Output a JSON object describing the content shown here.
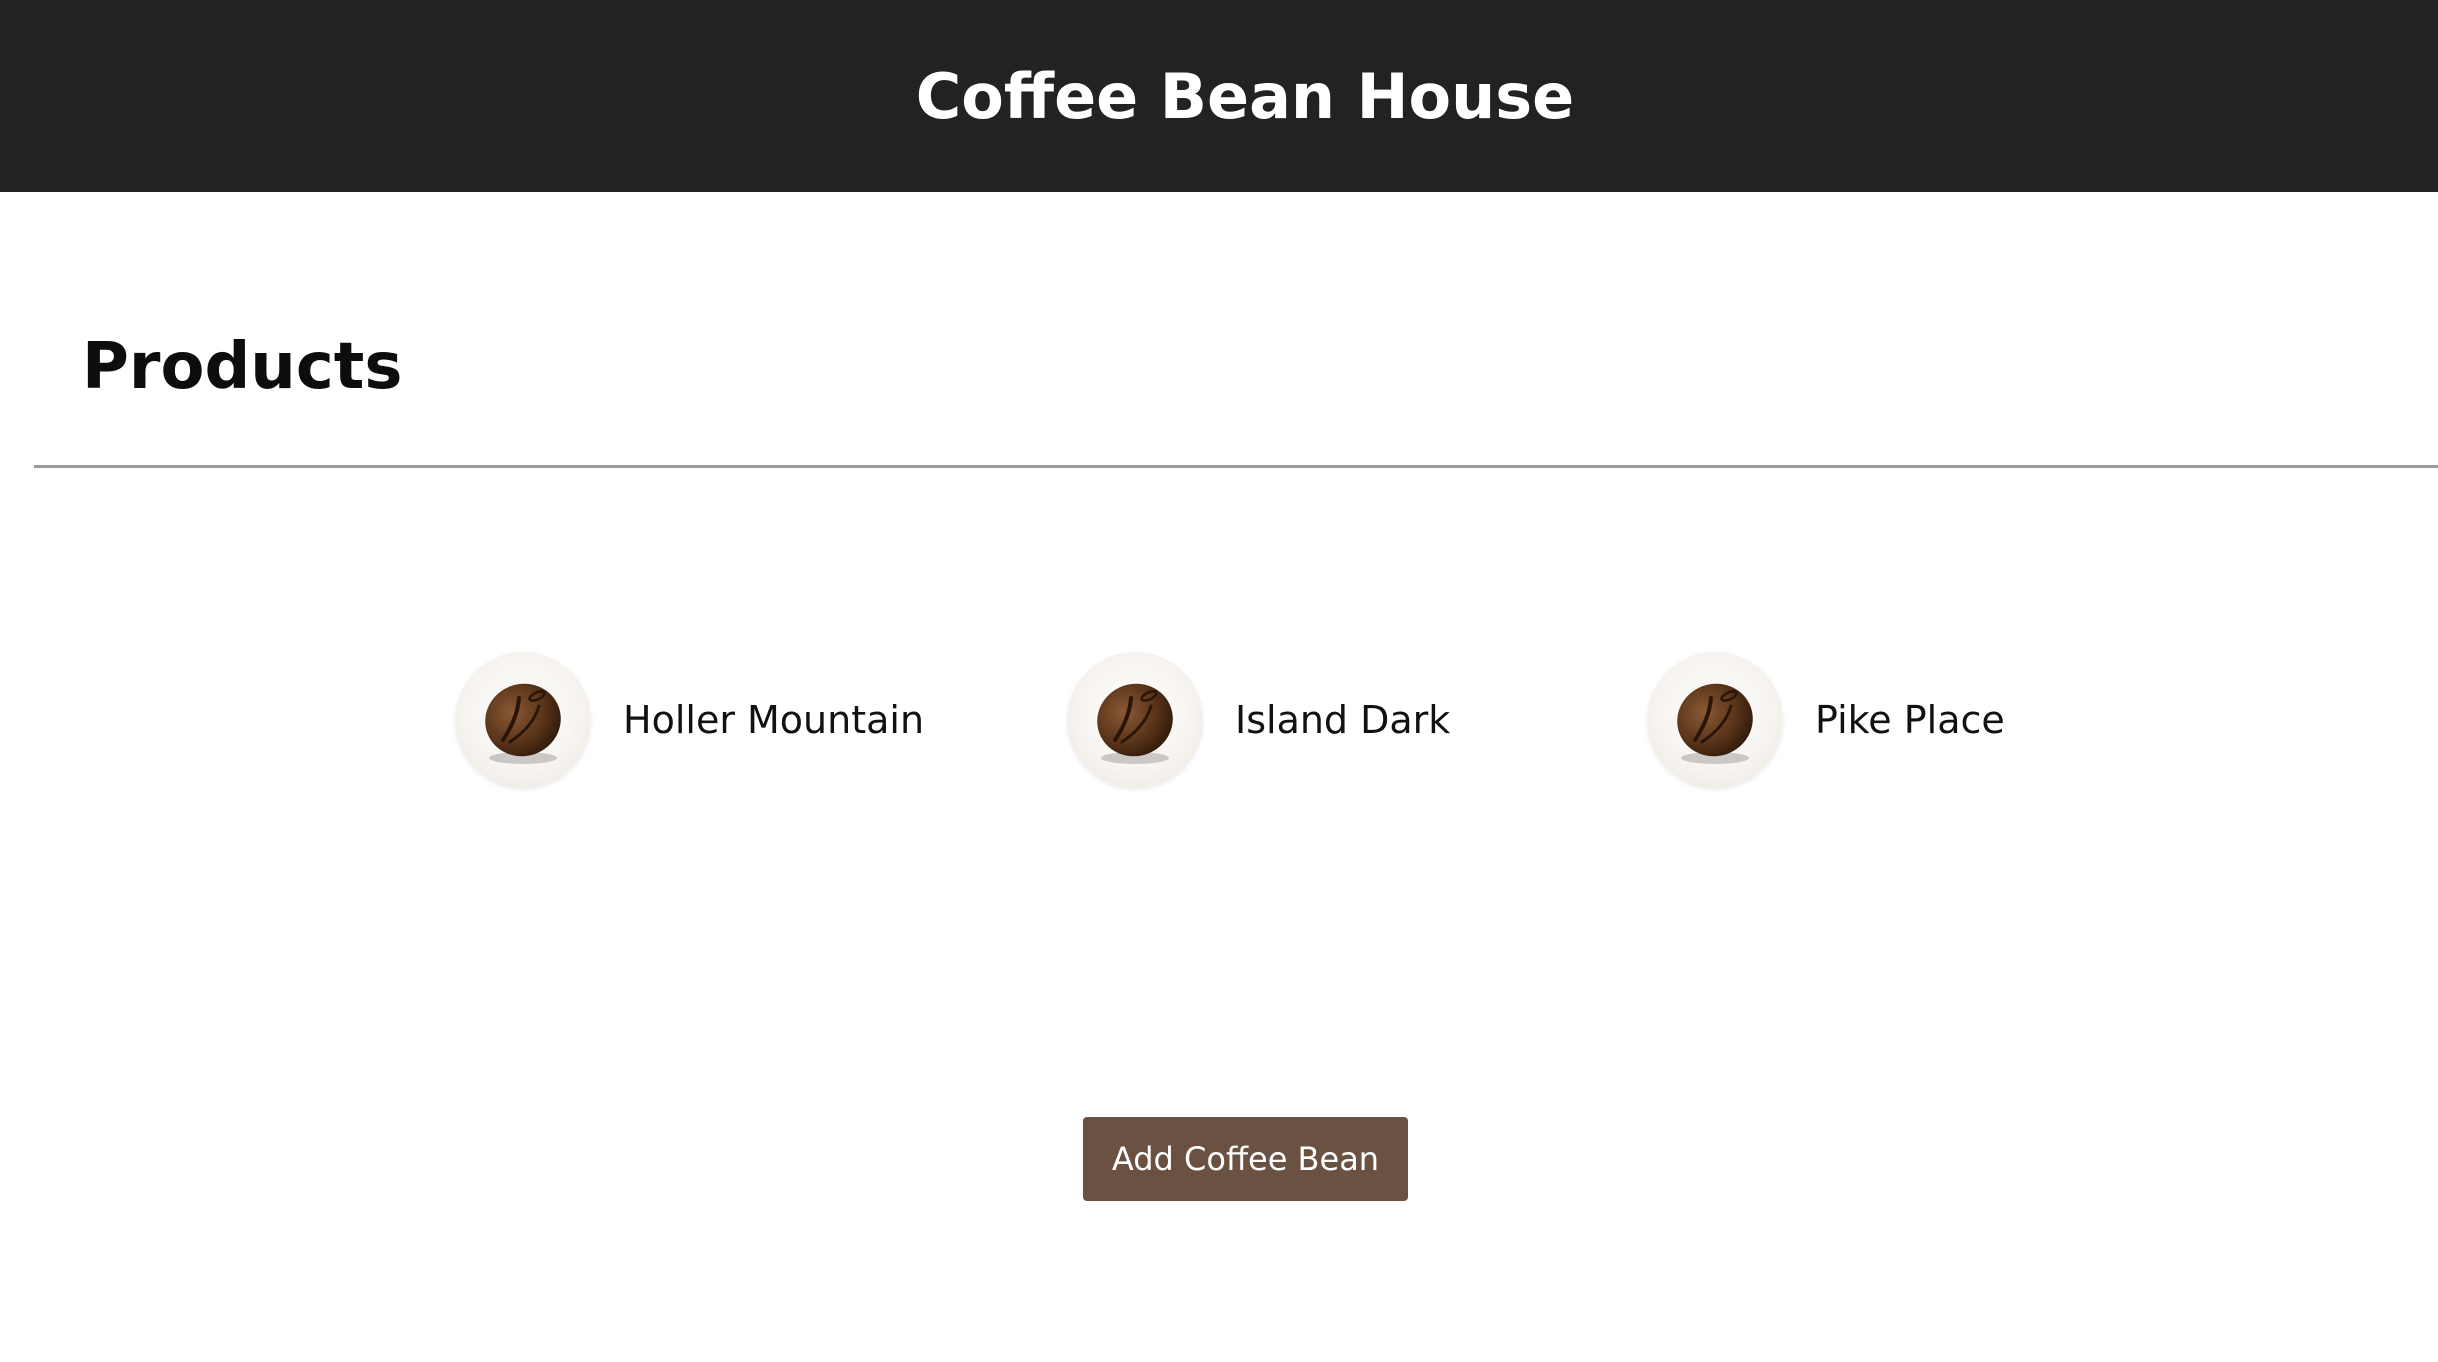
{
  "header": {
    "title": "Coffee Bean House"
  },
  "main": {
    "section_title": "Products",
    "products": [
      {
        "name": "Holler Mountain",
        "icon": "coffee-bean-icon"
      },
      {
        "name": "Island Dark",
        "icon": "coffee-bean-icon"
      },
      {
        "name": "Pike Place",
        "icon": "coffee-bean-icon"
      }
    ],
    "add_button_label": "Add Coffee Bean"
  },
  "colors": {
    "header_background": "#232122",
    "button_background": "#6b5141",
    "bean_dark": "#3e2312",
    "bean_light": "#8a5a35"
  }
}
